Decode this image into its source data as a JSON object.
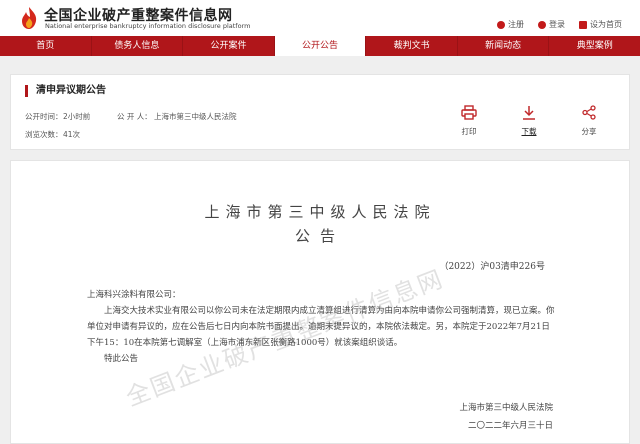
{
  "header": {
    "site_title": "全国企业破产重整案件信息网",
    "site_subtitle": "National enterprise bankruptcy information disclosure platform",
    "links": [
      "注册",
      "登录",
      "设为首页"
    ]
  },
  "nav": {
    "items": [
      "首页",
      "债务人信息",
      "公开案件",
      "公开公告",
      "裁判文书",
      "新闻动态",
      "典型案例"
    ],
    "active_index": 3
  },
  "notice": {
    "title": "清申异议期公告",
    "publish_time_label": "公开时间：",
    "publish_time_value": "2小时前",
    "publisher_label": "公 开 人：",
    "publisher_value": "上海市第三中级人民法院",
    "views_label": "浏览次数：",
    "views_value": "41次",
    "actions": {
      "print": "打印",
      "download": "下载",
      "share": "分享"
    }
  },
  "document": {
    "court": "上海市第三中级人民法院",
    "title": "公告",
    "case_no": "（2022）沪03清申226号",
    "addressee": "上海科兴涂料有限公司：",
    "body": "上海交大技术实业有限公司以你公司未在法定期限内成立清算组进行清算为由向本院申请你公司强制清算，现已立案。你单位对申请有异议的，应在公告后七日内向本院书面提出。逾期未提异议的，本院依法裁定。另，本院定于2022年7月21日下午15：10在本院第七调解室（上海市浦东新区张衡路1000号）就该案组织谈话。",
    "closing": "特此公告",
    "signature": "上海市第三中级人民法院",
    "date": "二〇二二年六月三十日"
  },
  "watermark": "全国企业破产重整案件信息网",
  "colors": {
    "brand": "#b0161a"
  }
}
